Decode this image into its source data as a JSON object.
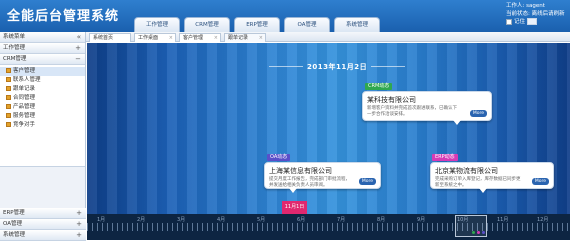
{
  "header": {
    "app_title": "全能后台管理系统",
    "system_tabs": [
      "工作管理",
      "CRM管理",
      "ERP管理",
      "OA管理",
      "系统管理"
    ],
    "user": {
      "line1": "工作人: sagent",
      "line2": "当前状态: 离线后请刷新",
      "remember_label": "记住"
    }
  },
  "sidebar": {
    "head_label": "系统菜单",
    "sections": [
      {
        "label": "工作管理",
        "toggle": "+"
      },
      {
        "label": "CRM管理",
        "toggle": "−"
      }
    ],
    "items": [
      "客户管理",
      "联系人管理",
      "跟单记录",
      "合同管理",
      "产品管理",
      "服务管理",
      "竞争对手"
    ],
    "bottom_sections": [
      {
        "label": "ERP管理",
        "toggle": "+"
      },
      {
        "label": "OA管理",
        "toggle": "+"
      },
      {
        "label": "系统管理",
        "toggle": "+"
      }
    ]
  },
  "page_tabs": [
    "系统首页",
    "工作桌面",
    "客户管理",
    "跟单记录"
  ],
  "canvas": {
    "date_label": "2013年11月2日",
    "events": [
      {
        "tag": "CRM动态",
        "tag_color": "#2fa84f",
        "title": "某科技有限公司",
        "text": "新增客户资料并完成首次跟进联系，已确认下一步合作洽谈安排。",
        "more": "More"
      },
      {
        "tag": "OA动态",
        "tag_color": "#5a4fc9",
        "title": "上海某信息有限公司",
        "text": "提交月度工作报告，完成部门审批流程，并发送给相关负责人员审阅。",
        "more": "More"
      },
      {
        "tag": "ERP动态",
        "tag_color": "#d63bb6",
        "title": "北京某物流有限公司",
        "text": "完成采购订单入库登记，库存数据已同步更新至系统之中。",
        "more": "More"
      }
    ],
    "marker_label": "11月1日"
  },
  "timeline": {
    "tick_labels": [
      "1月",
      "2月",
      "3月",
      "4月",
      "5月",
      "6月",
      "7月",
      "8月",
      "9月",
      "10月",
      "11月",
      "12月"
    ]
  }
}
